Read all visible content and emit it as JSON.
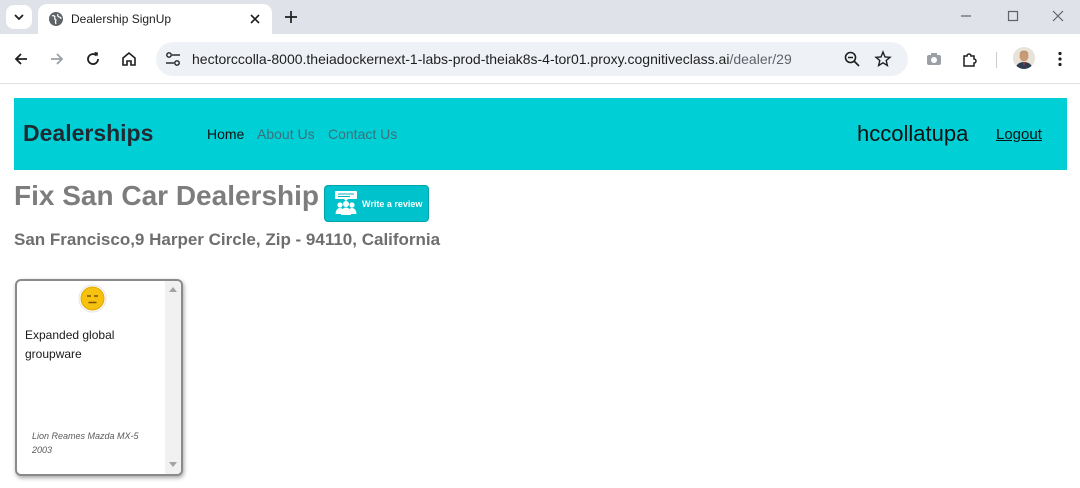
{
  "browser": {
    "tab_title": "Dealership SignUp",
    "url_host": "hectorccolla-8000.theiadockernext-1-labs-prod-theiak8s-4-tor01.proxy.cognitiveclass.ai",
    "url_path": "/dealer/29"
  },
  "navbar": {
    "brand": "Dealerships",
    "links": [
      "Home",
      "About Us",
      "Contact Us"
    ],
    "active_link": "Home",
    "username": "hccollatupa",
    "logout": "Logout",
    "color": "#00cfd6"
  },
  "dealer": {
    "name": "Fix San Car Dealership",
    "address": "San Francisco,9 Harper Circle, Zip - 94110, California"
  },
  "review_button": {
    "label": "Write a review",
    "icon": "people-review-icon"
  },
  "reviews": [
    {
      "sentiment_icon": "neutral-face-icon",
      "text": "Expanded global groupware",
      "reviewer_car": "Lion Reames Mazda MX-5",
      "year": "2003"
    }
  ]
}
